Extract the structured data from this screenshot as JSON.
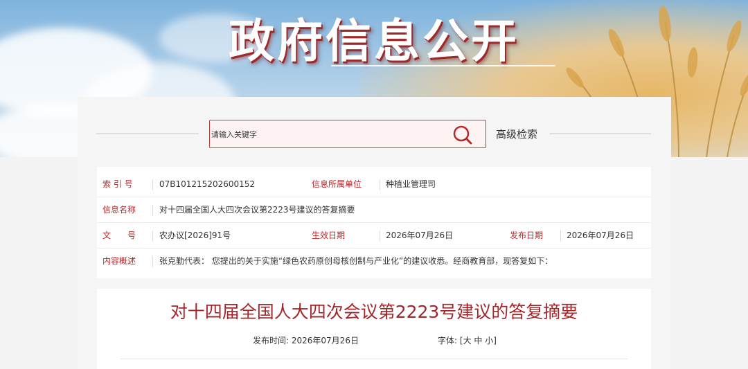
{
  "banner": {
    "title": "政府信息公开"
  },
  "search": {
    "placeholder": "请输入关键字",
    "advanced_label": "高级检索"
  },
  "info": {
    "index_label": "索 引 号",
    "index_value": "07B101215202600152",
    "unit_label": "信息所属单位",
    "unit_value": "种植业管理司",
    "name_label": "信息名称",
    "name_value": "对十四届全国人大四次会议第2223号建议的答复摘要",
    "doc_no_label": "文　　号",
    "doc_no_value": "农办议[2026]91号",
    "effective_label": "生效日期",
    "effective_value": "2026年07月26日",
    "publish_label": "发布日期",
    "publish_value": "2026年07月26日",
    "summary_label": "内容概述",
    "summary_value": "张克勤代表：  您提出的关于实施“绿色农药原创母核创制与产业化”的建议收悉。经商教育部，现答复如下："
  },
  "article": {
    "title": "对十四届全国人大四次会议第2223号建议的答复摘要",
    "publish_time_label": "发布时间:",
    "publish_time_value": "2026年07月26日",
    "font_label": "字体:",
    "font_open": "[",
    "font_large": "大",
    "font_medium": "中",
    "font_small": "小",
    "font_close": "]"
  },
  "colors": {
    "accent": "#b5282c",
    "title_red": "#a5262a"
  },
  "icons": {
    "search": "search-icon"
  }
}
